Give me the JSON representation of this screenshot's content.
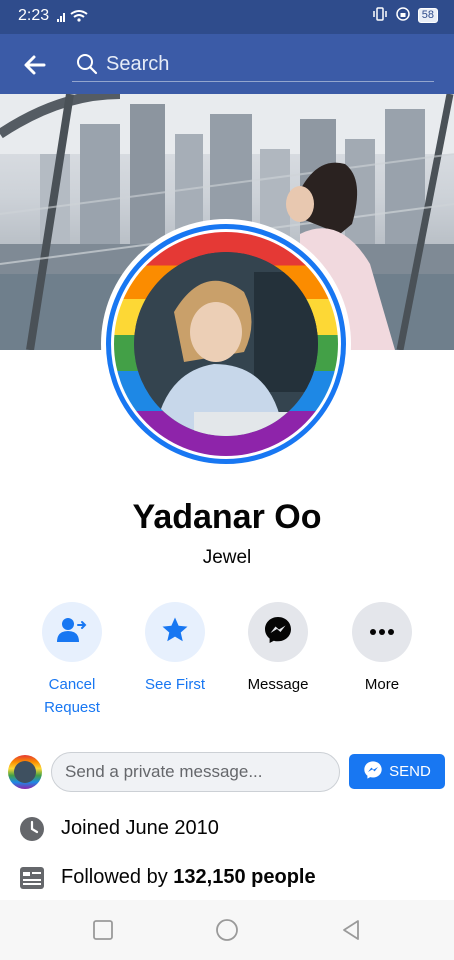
{
  "status_bar": {
    "time": "2:23",
    "battery": "58"
  },
  "header": {
    "search_placeholder": "Search"
  },
  "profile": {
    "name": "Yadanar Oo",
    "nickname": "Jewel"
  },
  "actions": [
    {
      "label_line1": "Cancel",
      "label_line2": "Request",
      "icon": "person-arrow-icon"
    },
    {
      "label_line1": "See First",
      "icon": "star-icon"
    },
    {
      "label_line1": "Message",
      "icon": "messenger-icon"
    },
    {
      "label_line1": "More",
      "icon": "more-dots-icon"
    }
  ],
  "message_bar": {
    "placeholder": "Send a private message...",
    "send_label": "SEND"
  },
  "info": {
    "joined": "Joined June 2010",
    "followed_prefix": "Followed by ",
    "followed_count": "132,150 people"
  },
  "colors": {
    "header": "#3b5ba7",
    "accent": "#1877f2"
  }
}
